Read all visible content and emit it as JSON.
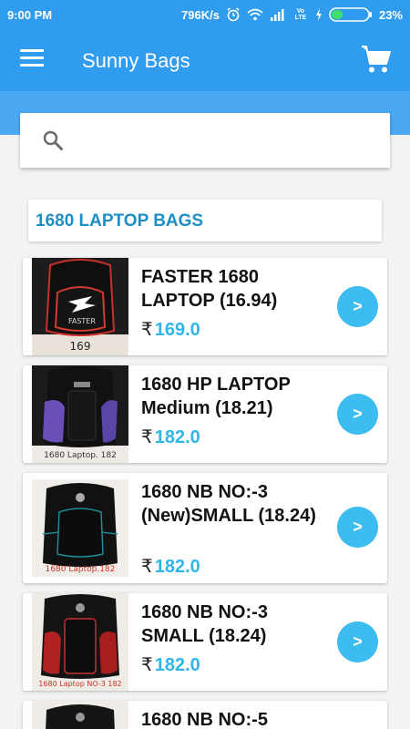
{
  "status_bar": {
    "time": "9:00 PM",
    "speed": "796K/s",
    "net": "Vo LTE",
    "battery": "23%"
  },
  "app_bar": {
    "title": "Sunny Bags",
    "menu_icon": "hamburger-icon",
    "cart_icon": "cart-icon"
  },
  "search": {
    "placeholder": "",
    "icon": "search-icon"
  },
  "category": {
    "label": "1680 LAPTOP BAGS"
  },
  "products": [
    {
      "name": "FASTER 1680 LAPTOP (16.94)",
      "currency": "₹",
      "price": "169.0",
      "go": ">",
      "image_caption": "169"
    },
    {
      "name": "1680 HP LAPTOP Medium (18.21)",
      "currency": "₹",
      "price": "182.0",
      "go": ">",
      "image_caption": "1680 Laptop. 182"
    },
    {
      "name": "1680 NB NO:-3 (New)SMALL (18.24)",
      "currency": "₹",
      "price": "182.0",
      "go": ">",
      "image_caption": "1680 Laptop.182"
    },
    {
      "name": "1680 NB NO:-3 SMALL (18.24)",
      "currency": "₹",
      "price": "182.0",
      "go": ">",
      "image_caption": "1680 Laptop NO-3 182"
    },
    {
      "name": "1680 NB NO:-5",
      "currency": "",
      "price": "",
      "go": "",
      "image_caption": ""
    }
  ]
}
